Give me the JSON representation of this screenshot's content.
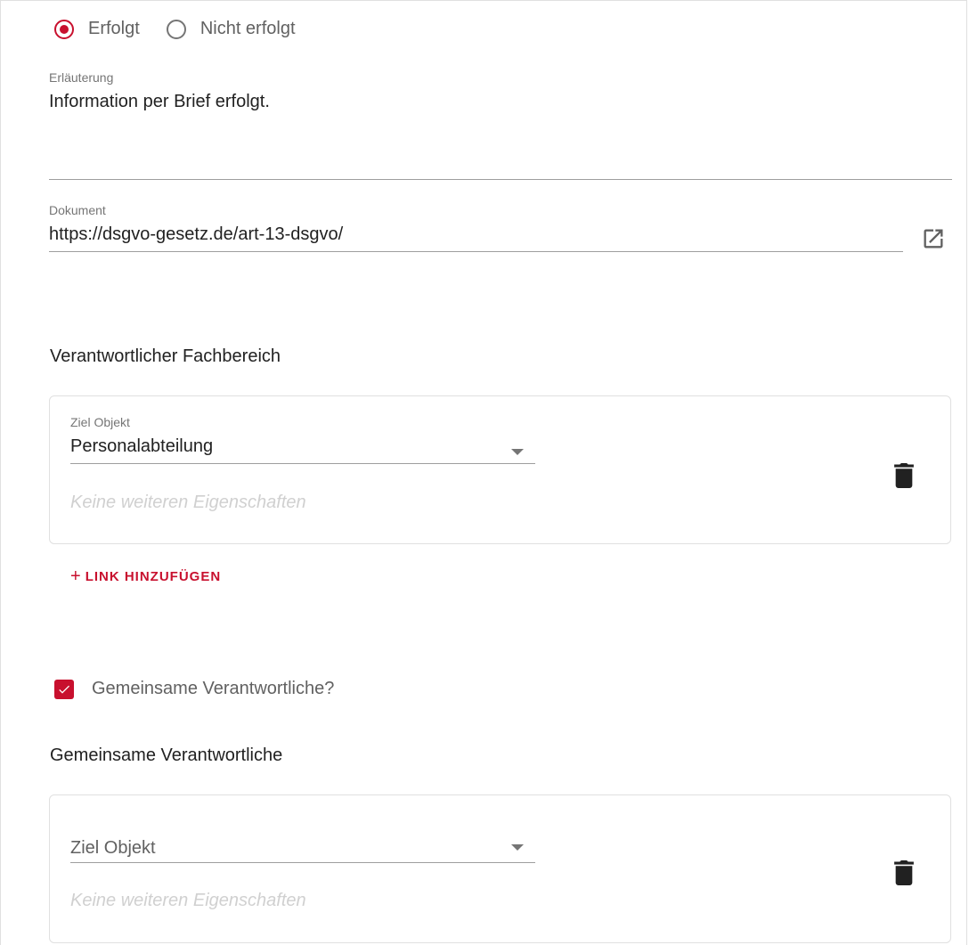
{
  "radio": {
    "option_success": "Erfolgt",
    "option_failure": "Nicht erfolgt",
    "selected": "Erfolgt"
  },
  "explanation": {
    "label": "Erläuterung",
    "value": "Information per Brief erfolgt."
  },
  "document": {
    "label": "Dokument",
    "value": "https://dsgvo-gesetz.de/art-13-dsgvo/",
    "open_icon": "open-in-new-icon"
  },
  "responsible_department": {
    "title": "Verantwortlicher Fachbereich",
    "card": {
      "field_label": "Ziel Objekt",
      "selected_value": "Personalabteilung",
      "hint": "Keine weiteren Eigenschaften",
      "delete_icon": "trash-icon"
    },
    "add_link_label": "LINK HINZUFÜGEN"
  },
  "joint_controllers_checkbox": {
    "label": "Gemeinsame Verantwortliche?",
    "checked": true
  },
  "joint_controllers": {
    "title": "Gemeinsame Verantwortliche",
    "card": {
      "placeholder": "Ziel Objekt",
      "hint": "Keine weiteren Eigenschaften",
      "delete_icon": "trash-icon"
    }
  },
  "colors": {
    "accent": "#c8102e"
  }
}
